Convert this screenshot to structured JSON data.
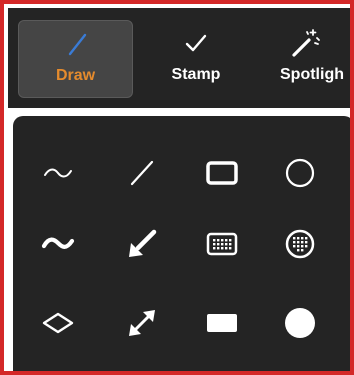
{
  "toolbar": {
    "draw_label": "Draw",
    "stamp_label": "Stamp",
    "spotlight_label": "Spotligh",
    "active_color": "#e58b2d",
    "draw_icon": "pen-icon",
    "stamp_icon": "checkmark-icon",
    "spotlight_icon": "magic-wand-icon"
  },
  "draw_tools": [
    [
      "thin-freehand-line-icon",
      "thin-straight-line-icon",
      "rectangle-outline-icon",
      "ellipse-outline-icon"
    ],
    [
      "thick-freehand-line-icon",
      "thick-arrow-icon",
      "semi-transparent-rectangle-icon",
      "semi-transparent-ellipse-icon"
    ],
    [
      "diamond-outline-icon",
      "double-arrow-icon",
      "filled-rectangle-icon",
      "filled-ellipse-icon"
    ]
  ],
  "colors": {
    "frame_border": "#d42828",
    "panel_bg": "#242424",
    "active_button_bg": "#454545",
    "icon_color": "#ffffff",
    "draw_icon_color": "#3a7bd5"
  }
}
